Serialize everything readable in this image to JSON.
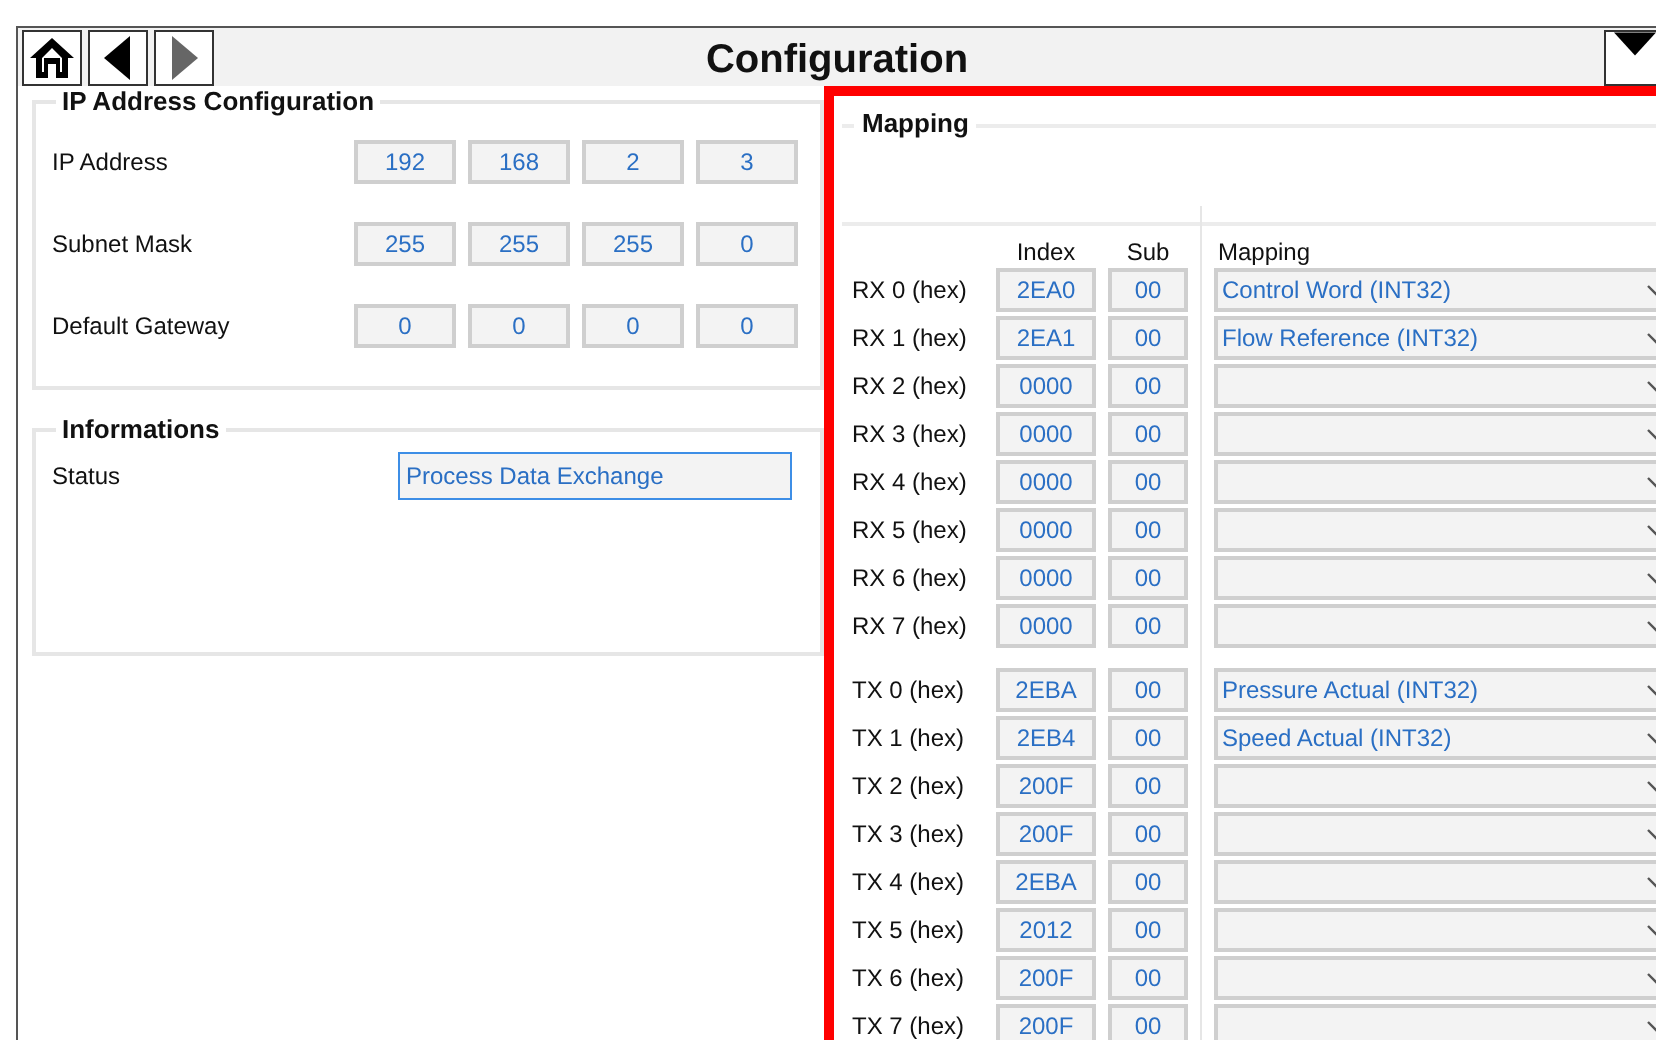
{
  "header": {
    "title": "Configuration",
    "nav": [
      {
        "kind": "home",
        "disabled": false
      },
      {
        "kind": "back",
        "disabled": false
      },
      {
        "kind": "forward",
        "disabled": true
      }
    ]
  },
  "ip_configuration": {
    "title": "IP Address Configuration",
    "rows": [
      {
        "label": "IP Address",
        "octets": [
          "192",
          "168",
          "2",
          "3"
        ]
      },
      {
        "label": "Subnet Mask",
        "octets": [
          "255",
          "255",
          "255",
          "0"
        ]
      },
      {
        "label": "Default Gateway",
        "octets": [
          "0",
          "0",
          "0",
          "0"
        ]
      }
    ]
  },
  "informations": {
    "title": "Informations",
    "status": {
      "label": "Status",
      "value": "Process Data Exchange",
      "focused": true
    }
  },
  "mapping": {
    "title": "Mapping",
    "columns": {
      "index": "Index",
      "sub": "Sub",
      "mapping": "Mapping"
    },
    "rx": [
      {
        "label": "RX 0 (hex)",
        "index": "2EA0",
        "sub": "00",
        "mapping": "Control Word (INT32)"
      },
      {
        "label": "RX 1 (hex)",
        "index": "2EA1",
        "sub": "00",
        "mapping": "Flow Reference (INT32)"
      },
      {
        "label": "RX 2 (hex)",
        "index": "0000",
        "sub": "00"
      },
      {
        "label": "RX 3 (hex)",
        "index": "0000",
        "sub": "00"
      },
      {
        "label": "RX 4 (hex)",
        "index": "0000",
        "sub": "00"
      },
      {
        "label": "RX 5 (hex)",
        "index": "0000",
        "sub": "00"
      },
      {
        "label": "RX 6 (hex)",
        "index": "0000",
        "sub": "00"
      },
      {
        "label": "RX 7 (hex)",
        "index": "0000",
        "sub": "00"
      }
    ],
    "tx": [
      {
        "label": "TX 0 (hex)",
        "index": "2EBA",
        "sub": "00",
        "mapping": "Pressure Actual (INT32)"
      },
      {
        "label": "TX 1 (hex)",
        "index": "2EB4",
        "sub": "00",
        "mapping": "Speed Actual (INT32)"
      },
      {
        "label": "TX 2 (hex)",
        "index": "200F",
        "sub": "00"
      },
      {
        "label": "TX 3 (hex)",
        "index": "200F",
        "sub": "00"
      },
      {
        "label": "TX 4 (hex)",
        "index": "2EBA",
        "sub": "00"
      },
      {
        "label": "TX 5 (hex)",
        "index": "2012",
        "sub": "00"
      },
      {
        "label": "TX 6 (hex)",
        "index": "200F",
        "sub": "00"
      },
      {
        "label": "TX 7 (hex)",
        "index": "200F",
        "sub": "00"
      }
    ]
  }
}
